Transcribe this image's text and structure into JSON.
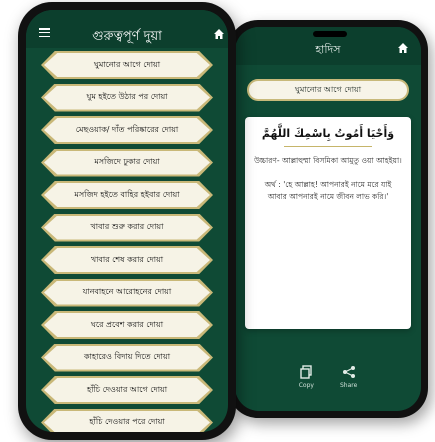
{
  "back_phone": {
    "title": "হাদিস",
    "banner": "ঘুমানোর আগে দোয়া",
    "arabic": "وَأَحْيَا أَمُوتُ بِاسْمِكَ اللَّهُمَّ",
    "pronunciation": "উচ্চারণ- আল্লাহুম্মা বিসমিকা আমুতু ওয়া আহইয়া।",
    "meaning": "অর্থ : 'হে আল্লাহ! আপনারই নামে মরে যাই আবার আপনারই নামে জীবন লাভ করি।'",
    "actions": [
      {
        "label": "Copy",
        "icon": "copy-icon"
      },
      {
        "label": "Share",
        "icon": "share-icon"
      }
    ]
  },
  "front_phone": {
    "title": "গুরুত্বপূর্ণ দুয়া",
    "menu_icon": "menu-icon",
    "home_icon": "home-icon",
    "items": [
      "ঘুমানোর আগে দোয়া",
      "ঘুম হইতে উঠার পর দোয়া",
      "মেছওয়াক/ দাঁত পরিষ্কারের দোয়া",
      "মসজিদে ঢুকার দোয়া",
      "মসজিদ হইতে বাহির হইবার দোয়া",
      "খাবার শুরু করার দোয়া",
      "খাবার শেষ করার দোয়া",
      "যানবাহনে আরোহনের দোয়া",
      "ঘরে প্রবেশ করার দোয়া",
      "কাহারেও বিদায় দিতে দোয়া",
      "হাঁচি দেওয়ার আগে দোয়া",
      "হাঁচি দেওয়ার পরে দোয়া"
    ]
  },
  "colors": {
    "screen_bg": "#0f4a35",
    "header_bg": "#0c3f2d",
    "button_bg": "#f6f3e6",
    "button_border": "#c9b878"
  }
}
